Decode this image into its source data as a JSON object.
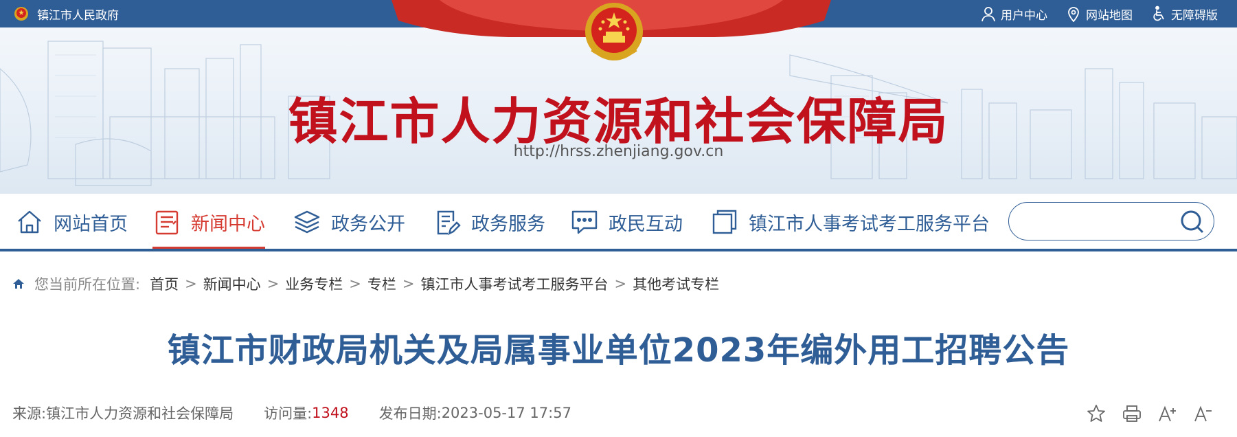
{
  "top_bar": {
    "gov_label": "镇江市人民政府",
    "links": [
      {
        "label": "用户中心",
        "icon": "user-icon"
      },
      {
        "label": "网站地图",
        "icon": "map-pin-icon"
      },
      {
        "label": "无障碍版",
        "icon": "accessibility-icon"
      }
    ]
  },
  "banner": {
    "title": "镇江市人力资源和社会保障局",
    "url": "http://hrss.zhenjiang.gov.cn"
  },
  "nav": {
    "items": [
      {
        "label": "网站首页",
        "icon": "home-icon",
        "active": false
      },
      {
        "label": "新闻中心",
        "icon": "news-icon",
        "active": true
      },
      {
        "label": "政务公开",
        "icon": "layers-icon",
        "active": false
      },
      {
        "label": "政务服务",
        "icon": "document-edit-icon",
        "active": false
      },
      {
        "label": "政民互动",
        "icon": "chat-icon",
        "active": false
      },
      {
        "label": "镇江市人事考试考工服务平台",
        "icon": "window-icon",
        "active": false
      }
    ],
    "search_placeholder": ""
  },
  "breadcrumb": {
    "prefix": "您当前所在位置:",
    "items": [
      "首页",
      "新闻中心",
      "业务专栏",
      "专栏",
      "镇江市人事考试考工服务平台",
      "其他考试专栏"
    ],
    "separator": ">"
  },
  "article": {
    "title": "镇江市财政局机关及局属事业单位2023年编外用工招聘公告",
    "source_label": "来源:",
    "source": "镇江市人力资源和社会保障局",
    "visits_label": "访问量:",
    "visits": "1348",
    "date_label": "发布日期:",
    "date": "2023-05-17 17:57"
  },
  "colors": {
    "brand_blue": "#2f5d96",
    "brand_red": "#c0111d",
    "active_red": "#d63b32"
  }
}
